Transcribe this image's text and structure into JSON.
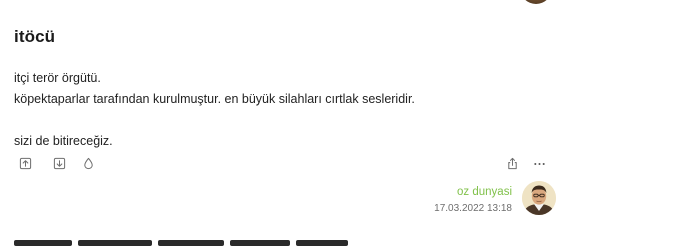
{
  "entry": {
    "title": "itöcü",
    "lines": [
      "itçi terör örgütü.",
      "köpektaparlar tarafından kurulmuştur. en büyük silahları cırtlak sesleridir.",
      "",
      "sizi de bitireceğiz."
    ],
    "author": "oz dunyasi",
    "date": "17.03.2022 13:18"
  },
  "actions": {
    "upvote_icon": "upvote-icon",
    "downvote_icon": "downvote-icon",
    "favorite_icon": "drop-icon",
    "share_icon": "share-icon",
    "more_icon": "more-icon",
    "more_label": "···"
  },
  "colors": {
    "author": "#81c14b",
    "icon": "#6f6f6f",
    "text": "#222222"
  }
}
